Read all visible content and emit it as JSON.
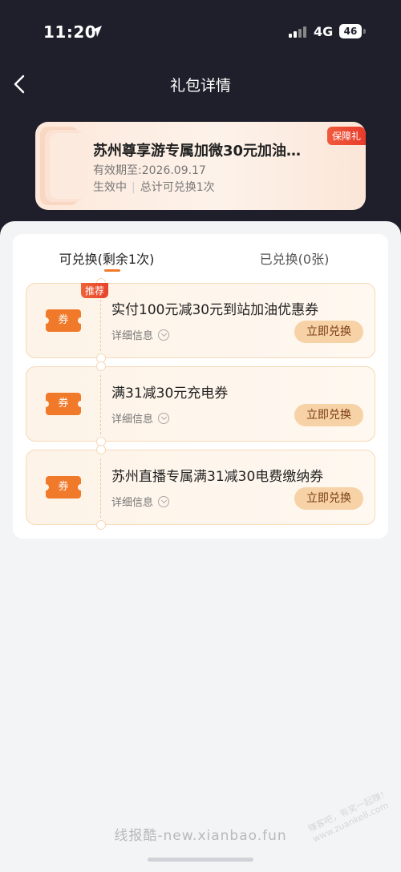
{
  "status_bar": {
    "time": "11:20",
    "network": "4G",
    "battery": "46"
  },
  "nav": {
    "title": "礼包详情"
  },
  "gift": {
    "name": "苏州尊享游专属加微30元加油…",
    "validity": "有效期至:2026.09.17",
    "status": "生效中",
    "total": "总计可兑换1次",
    "badge": "保障礼"
  },
  "tabs": [
    {
      "label": "可兑换(剩余1次)",
      "active": true
    },
    {
      "label": "已兑换(0张)",
      "active": false
    }
  ],
  "coupons": [
    {
      "title": "实付100元减30元到站加油优惠券",
      "detail": "详细信息",
      "button": "立即兑换",
      "tag": "推荐",
      "ticket": "券"
    },
    {
      "title": "满31减30元充电券",
      "detail": "详细信息",
      "button": "立即兑换",
      "ticket": "券"
    },
    {
      "title": "苏州直播专属满31减30电费缴纳券",
      "detail": "详细信息",
      "button": "立即兑换",
      "ticket": "券"
    }
  ],
  "watermark": {
    "text": "线报酷-new.xianbao.fun",
    "stamp": "赚客吧，有奖一起赚！ www.zuanke8.com"
  },
  "colors": {
    "accent": "#f07a2a",
    "header_bg": "#1f1f2b",
    "button_bg": "#f7d2a6"
  }
}
